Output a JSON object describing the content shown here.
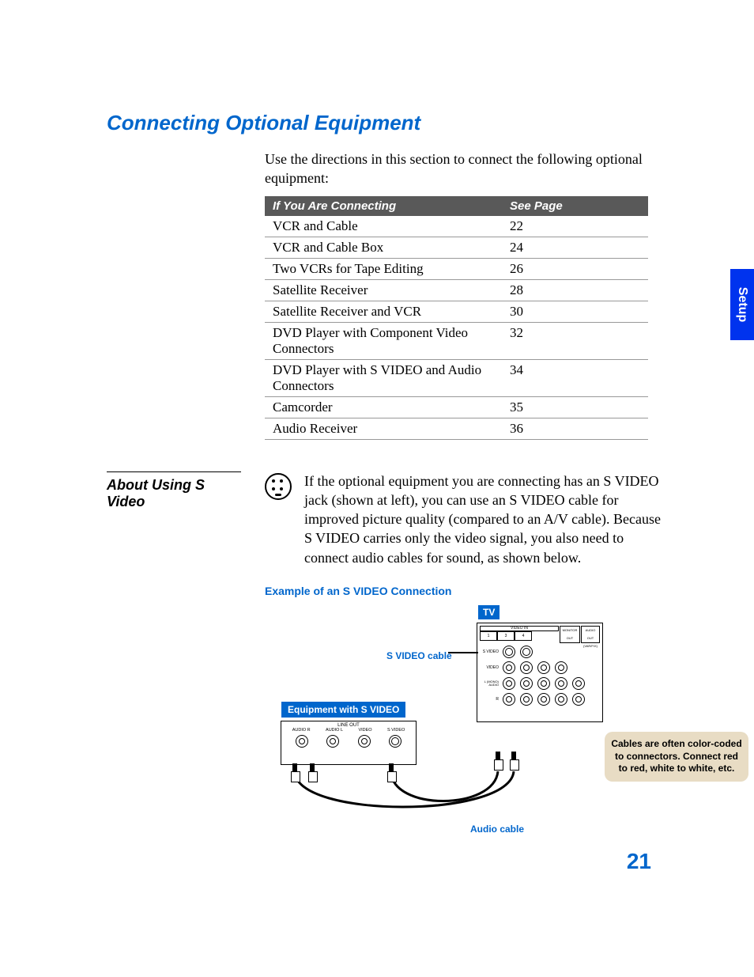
{
  "heading": "Connecting Optional Equipment",
  "intro": "Use the directions in this section to connect the following optional equipment:",
  "table": {
    "head": {
      "col1": "If You Are Connecting",
      "col2": "See Page"
    },
    "rows": [
      {
        "label": "VCR and Cable",
        "page": "22"
      },
      {
        "label": "VCR and Cable Box",
        "page": "24"
      },
      {
        "label": "Two VCRs for Tape Editing",
        "page": "26"
      },
      {
        "label": "Satellite Receiver",
        "page": "28"
      },
      {
        "label": "Satellite Receiver and VCR",
        "page": "30"
      },
      {
        "label": "DVD Player with Component Video Connectors",
        "page": "32"
      },
      {
        "label": "DVD Player with S VIDEO and Audio Connectors",
        "page": "34"
      },
      {
        "label": "Camcorder",
        "page": "35"
      },
      {
        "label": "Audio Receiver",
        "page": "36"
      }
    ]
  },
  "svideo": {
    "side_heading": "About Using S Video",
    "body": "If the optional equipment you are connecting has an S VIDEO jack (shown at left), you can use an S VIDEO cable for improved picture quality (compared to an A/V cable). Because S VIDEO carries only the video signal, you also need to connect audio cables for sound, as shown below.",
    "example_title": "Example of an S VIDEO Connection",
    "labels": {
      "tv": "TV",
      "svideo_cable": "S VIDEO cable",
      "equipment": "Equipment with S VIDEO",
      "audio_cable": "Audio cable"
    },
    "callout": "Cables are often color-coded to connectors. Connect red to red, white to white, etc.",
    "tv_panel": {
      "video_in": "VIDEO IN",
      "cols": [
        "1",
        "3",
        "4"
      ],
      "monitor_out": "MONITOR OUT",
      "audio_out": "AUDIO OUT (VAR/FIX)",
      "rows": [
        "S VIDEO",
        "VIDEO",
        "L (MONO) AUDIO",
        "R"
      ]
    },
    "equip_panel": {
      "line_out": "LINE OUT",
      "labels": [
        "AUDIO R",
        "AUDIO L",
        "VIDEO",
        "S VIDEO"
      ]
    }
  },
  "tab": "Setup",
  "page_number": "21"
}
